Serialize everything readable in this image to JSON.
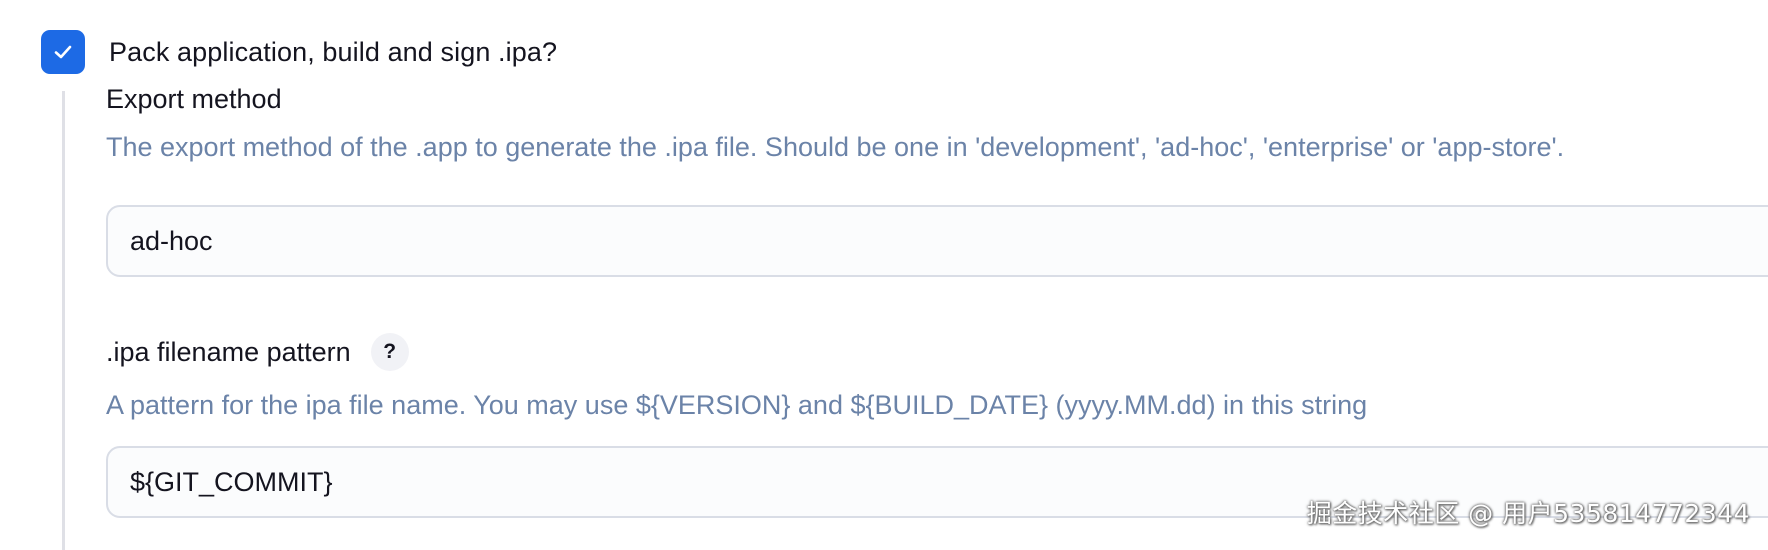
{
  "pack_option": {
    "label": "Pack application, build and sign .ipa?",
    "checked": true,
    "check_icon": "checkmark-icon",
    "accent_color": "#1d6ae5"
  },
  "export_method": {
    "title": "Export method",
    "description": "The export method of the .app to generate the .ipa file. Should be one in 'development', 'ad-hoc', 'enterprise' or 'app-store'.",
    "value": "ad-hoc"
  },
  "ipa_filename": {
    "title": ".ipa filename pattern",
    "help_label": "?",
    "description": "A pattern for the ipa file name. You may use ${VERSION} and ${BUILD_DATE} (yyyy.MM.dd) in this string",
    "value": "${GIT_COMMIT}"
  },
  "watermark": {
    "text": "掘金技术社区 @ 用户535814772344"
  },
  "colors": {
    "description_text": "#6b83a8",
    "input_border": "#d9dde6",
    "nested_bar": "#dfe0e6"
  }
}
